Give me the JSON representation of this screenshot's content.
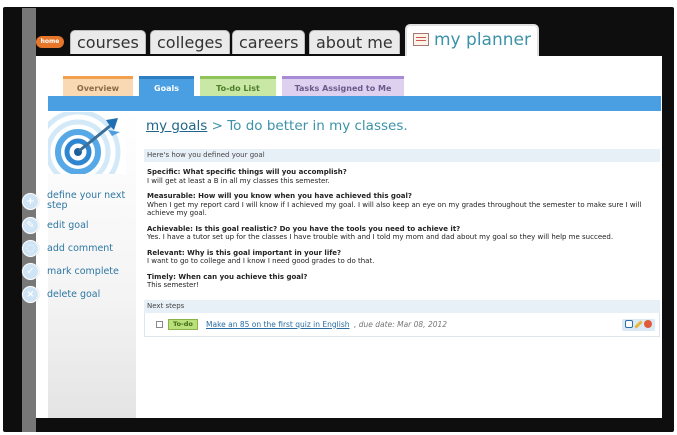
{
  "nav": {
    "home": "home",
    "tabs": [
      {
        "label": "courses"
      },
      {
        "label": "colleges"
      },
      {
        "label": "careers"
      },
      {
        "label": "about me"
      }
    ],
    "active_tab": "my planner"
  },
  "subtabs": [
    {
      "label": "Overview",
      "color": "#f6b674"
    },
    {
      "label": "Goals",
      "color": "#4a9fe2"
    },
    {
      "label": "To-do List",
      "color": "#b5e08b"
    },
    {
      "label": "Tasks Assigned to Me",
      "color": "#c9b7e6"
    }
  ],
  "sidebar": {
    "actions": [
      {
        "label": "define your next step",
        "icon": "plus-icon"
      },
      {
        "label": "edit goal",
        "icon": "pencil-icon"
      },
      {
        "label": "add comment",
        "icon": "comment-icon"
      },
      {
        "label": "mark complete",
        "icon": "check-icon"
      },
      {
        "label": "delete goal",
        "icon": "x-icon"
      }
    ]
  },
  "breadcrumb": {
    "link": "my goals",
    "sep": ">",
    "title": "To do better in my classes."
  },
  "definition": {
    "header": "Here's how you defined your goal",
    "items": [
      {
        "q": "Specific: What specific things will you accomplish?",
        "a": "I will get at least a B in all my classes this semester."
      },
      {
        "q": "Measurable: How will you know when you have achieved this goal?",
        "a": "When I get my report card I will know if I achieved my goal. I will also keep an eye on my grades throughout the semester to make sure I will achieve my goal."
      },
      {
        "q": "Achievable: Is this goal realistic? Do you have the tools you need to achieve it?",
        "a": "Yes. I have a tutor set up for the classes I have trouble with and I told my mom and dad about my goal so they will help me succeed."
      },
      {
        "q": "Relevant: Why is this goal important in your life?",
        "a": "I want to go to college and I know I need good grades to do that."
      },
      {
        "q": "Timely: When can you achieve this goal?",
        "a": "This semester!"
      }
    ]
  },
  "next_steps": {
    "header": "Next steps",
    "badge": "To-do",
    "link": "Make an 85 on the first quiz in English",
    "due": ", due date: Mar 08, 2012"
  }
}
